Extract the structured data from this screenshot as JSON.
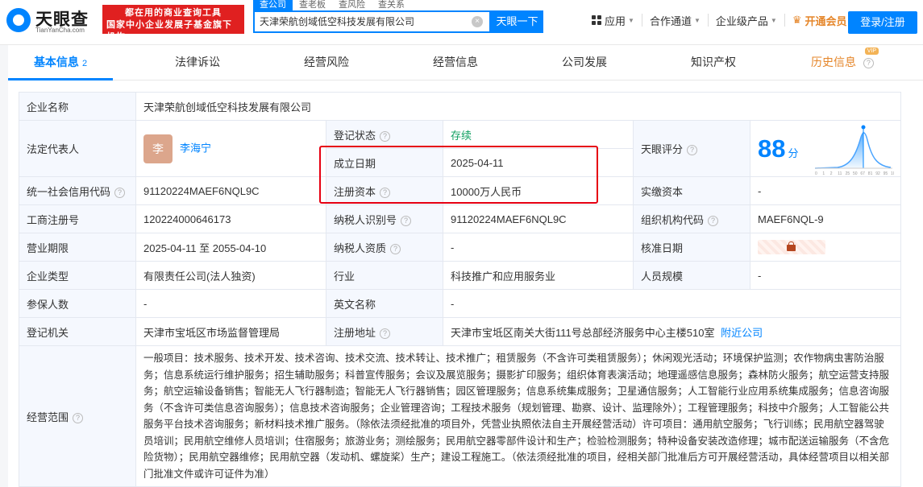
{
  "header": {
    "logo": {
      "brand": "天眼查",
      "domain": "TianYanCha.com"
    },
    "slogan": {
      "line1": "都在用的商业查询工具",
      "line2": "国家中小企业发展子基金旗下机构"
    },
    "search": {
      "tabs": [
        "查公司",
        "查老板",
        "查风险",
        "查关系"
      ],
      "value": "天津荣航创域低空科技发展有限公司",
      "button": "天眼一下"
    },
    "nav": {
      "app": "应用",
      "cooperation": "合作通道",
      "enterprise": "企业级产品",
      "vip": "开通会员"
    },
    "login": "登录/注册"
  },
  "tabs": [
    {
      "label": "基本信息",
      "count": "2"
    },
    {
      "label": "法律诉讼"
    },
    {
      "label": "经营风险"
    },
    {
      "label": "经营信息"
    },
    {
      "label": "公司发展"
    },
    {
      "label": "知识产权"
    },
    {
      "label": "历史信息",
      "badge": "VIP"
    }
  ],
  "info": {
    "company_name": {
      "label": "企业名称",
      "value": "天津荣航创域低空科技发展有限公司"
    },
    "legal_rep": {
      "label": "法定代表人",
      "avatar": "李",
      "name": "李海宁"
    },
    "status": {
      "label": "登记状态",
      "value": "存续"
    },
    "score": {
      "label": "天眼评分",
      "value": "88",
      "unit": "分",
      "axis": [
        "0",
        "1",
        "2",
        "11",
        "25",
        "50",
        "67",
        "81",
        "92",
        "95",
        "100"
      ]
    },
    "founded": {
      "label": "成立日期",
      "value": "2025-04-11"
    },
    "capital": {
      "label": "注册资本",
      "value": "10000万人民币"
    },
    "credit_code": {
      "label": "统一社会信用代码",
      "value": "91120224MAEF6NQL9C"
    },
    "paid_capital": {
      "label": "实缴资本",
      "value": "-"
    },
    "reg_no": {
      "label": "工商注册号",
      "value": "120224000646173"
    },
    "taxpayer_id": {
      "label": "纳税人识别号",
      "value": "91120224MAEF6NQL9C"
    },
    "org_code": {
      "label": "组织机构代码",
      "value": "MAEF6NQL-9"
    },
    "term": {
      "label": "营业期限",
      "value": "2025-04-11 至 2055-04-10"
    },
    "taxpayer_qual": {
      "label": "纳税人资质",
      "value": "-"
    },
    "approval_date": {
      "label": "核准日期"
    },
    "type": {
      "label": "企业类型",
      "value": "有限责任公司(法人独资)"
    },
    "industry": {
      "label": "行业",
      "value": "科技推广和应用服务业"
    },
    "staff_size": {
      "label": "人员规模",
      "value": "-"
    },
    "insured": {
      "label": "参保人数",
      "value": "-"
    },
    "english_name": {
      "label": "英文名称",
      "value": "-"
    },
    "authority": {
      "label": "登记机关",
      "value": "天津市宝坻区市场监督管理局"
    },
    "address": {
      "label": "注册地址",
      "value": "天津市宝坻区南关大街111号总部经济服务中心主楼510室",
      "link": "附近公司"
    },
    "scope": {
      "label": "经营范围",
      "value": "一般项目：技术服务、技术开发、技术咨询、技术交流、技术转让、技术推广；租赁服务（不含许可类租赁服务）；休闲观光活动；环境保护监测；农作物病虫害防治服务；信息系统运行维护服务；招生辅助服务；科普宣传服务；会议及展览服务；摄影扩印服务；组织体育表演活动；地理遥感信息服务；森林防火服务；航空运营支持服务；航空运输设备销售；智能无人飞行器制造；智能无人飞行器销售；园区管理服务；信息系统集成服务；卫星通信服务；人工智能行业应用系统集成服务；信息咨询服务（不含许可类信息咨询服务）；信息技术咨询服务；企业管理咨询；工程技术服务（规划管理、勘察、设计、监理除外）；工程管理服务；科技中介服务；人工智能公共服务平台技术咨询服务；新材料技术推广服务。（除依法须经批准的项目外，凭营业执照依法自主开展经营活动）许可项目：通用航空服务；飞行训练；民用航空器驾驶员培训；民用航空维修人员培训；住宿服务；旅游业务；测绘服务；民用航空器零部件设计和生产；检验检测服务；特种设备安装改造修理；城市配送运输服务（不含危险货物）；民用航空器维修；民用航空器（发动机、螺旋桨）生产；建设工程施工。（依法须经批准的项目，经相关部门批准后方可开展经营活动，具体经营项目以相关部门批准文件或许可证件为准）"
    }
  },
  "colors": {
    "accent": "#0084ff",
    "status_green": "#11a061",
    "highlight_red": "#e60012",
    "vip_orange": "#e5862a"
  }
}
